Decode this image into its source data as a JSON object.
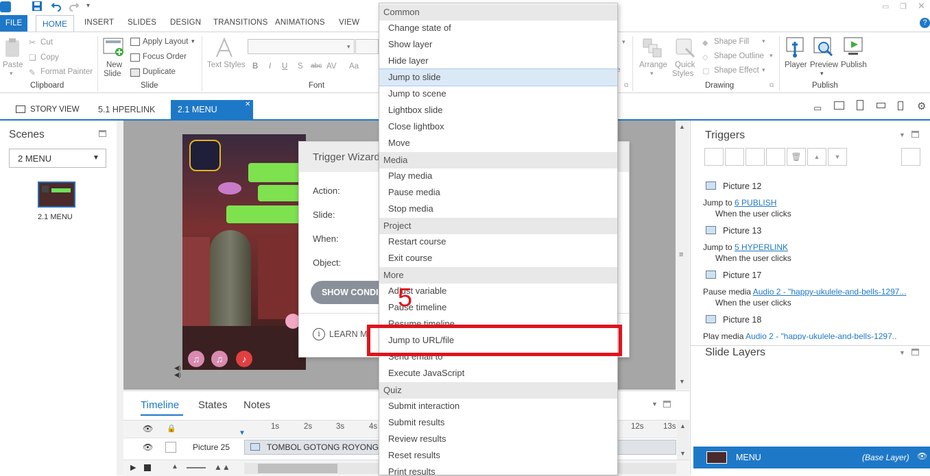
{
  "ribbon_tabs": {
    "file": "FILE",
    "home": "HOME",
    "insert": "INSERT",
    "slides": "SLIDES",
    "design": "DESIGN",
    "transitions": "TRANSITIONS",
    "animations": "ANIMATIONS",
    "view": "VIEW"
  },
  "clipboard": {
    "paste": "Paste",
    "cut": "Cut",
    "copy": "Copy",
    "format_painter": "Format Painter",
    "group": "Clipboard"
  },
  "slide_group": {
    "new_slide_line1": "New",
    "new_slide_line2": "Slide",
    "apply_layout": "Apply Layout",
    "focus_order": "Focus Order",
    "duplicate": "Duplicate",
    "group": "Slide"
  },
  "font_group": {
    "text_styles": "Text Styles",
    "group": "Font",
    "bold": "B",
    "italic": "I",
    "underline": "U",
    "strike": "S",
    "abc": "abc",
    "av": "AV",
    "aa": "Aa"
  },
  "drawing": {
    "arrange": "Arrange",
    "quick_styles_line1": "Quick",
    "quick_styles_line2": "Styles",
    "shape_fill": "Shape Fill",
    "shape_outline": "Shape Outline",
    "shape_effect": "Shape Effect",
    "group": "Drawing"
  },
  "publish_group": {
    "player": "Player",
    "preview": "Preview",
    "publish": "Publish",
    "group": "Publish"
  },
  "doc_tabs": {
    "story_view": "STORY VIEW",
    "hyperlink": "5.1 HPERLINK",
    "menu": "2.1 MENU"
  },
  "scenes": {
    "title": "Scenes",
    "selected": "2 MENU",
    "thumb_label": "2.1 MENU"
  },
  "wizard": {
    "title": "Trigger Wizard",
    "action": "Action:",
    "slide": "Slide:",
    "when": "When:",
    "object": "Object:",
    "show_conditions": "SHOW CONDI",
    "learn_more": "LEARN M"
  },
  "dropdown": {
    "sections": [
      {
        "header": "Common",
        "items": [
          "Change state of",
          "Show layer",
          "Hide layer",
          "Jump to slide",
          "Jump to scene",
          "Lightbox slide",
          "Close lightbox",
          "Move"
        ]
      },
      {
        "header": "Media",
        "items": [
          "Play media",
          "Pause media",
          "Stop media"
        ]
      },
      {
        "header": "Project",
        "items": [
          "Restart course",
          "Exit course"
        ]
      },
      {
        "header": "More",
        "items": [
          "Adjust variable",
          "Pause timeline",
          "Resume timeline",
          "Jump to URL/file",
          "Send email to",
          "Execute JavaScript"
        ]
      },
      {
        "header": "Quiz",
        "items": [
          "Submit interaction",
          "Submit results",
          "Review results",
          "Reset results",
          "Print results"
        ]
      }
    ],
    "selected": "Jump to slide",
    "highlighted": "Jump to URL/file"
  },
  "annotation": {
    "step": "5"
  },
  "timeline": {
    "tab_timeline": "Timeline",
    "tab_states": "States",
    "tab_notes": "Notes",
    "ruler": [
      "1s",
      "2s",
      "3s",
      "4s",
      "12s",
      "13s"
    ],
    "row_name": "Picture 25",
    "row_clip": "TOMBOL GOTONG ROYONG (5)"
  },
  "triggers": {
    "title": "Triggers",
    "items": [
      {
        "name": "Picture 12",
        "action": "Jump to ",
        "target": "6 PUBLISH",
        "when": "When the user clicks"
      },
      {
        "name": "Picture 13",
        "action": "Jump to ",
        "target": "5 HYPERLINK",
        "when": "When the user clicks"
      },
      {
        "name": "Picture 17",
        "action": "Pause media ",
        "target": "Audio 2 - \"happy-ukulele-and-bells-1297...",
        "when": "When the user clicks"
      },
      {
        "name": "Picture 18",
        "action": "Play media ",
        "target": "Audio 2 - \"happy-ukulele-and-bells-1297...",
        "when": ""
      }
    ]
  },
  "slide_layers": {
    "title": "Slide Layers",
    "base_name": "MENU",
    "base_tag": "(Base Layer)"
  },
  "colors": {
    "accent": "#1e78c8",
    "highlight_red": "#e2121b"
  }
}
